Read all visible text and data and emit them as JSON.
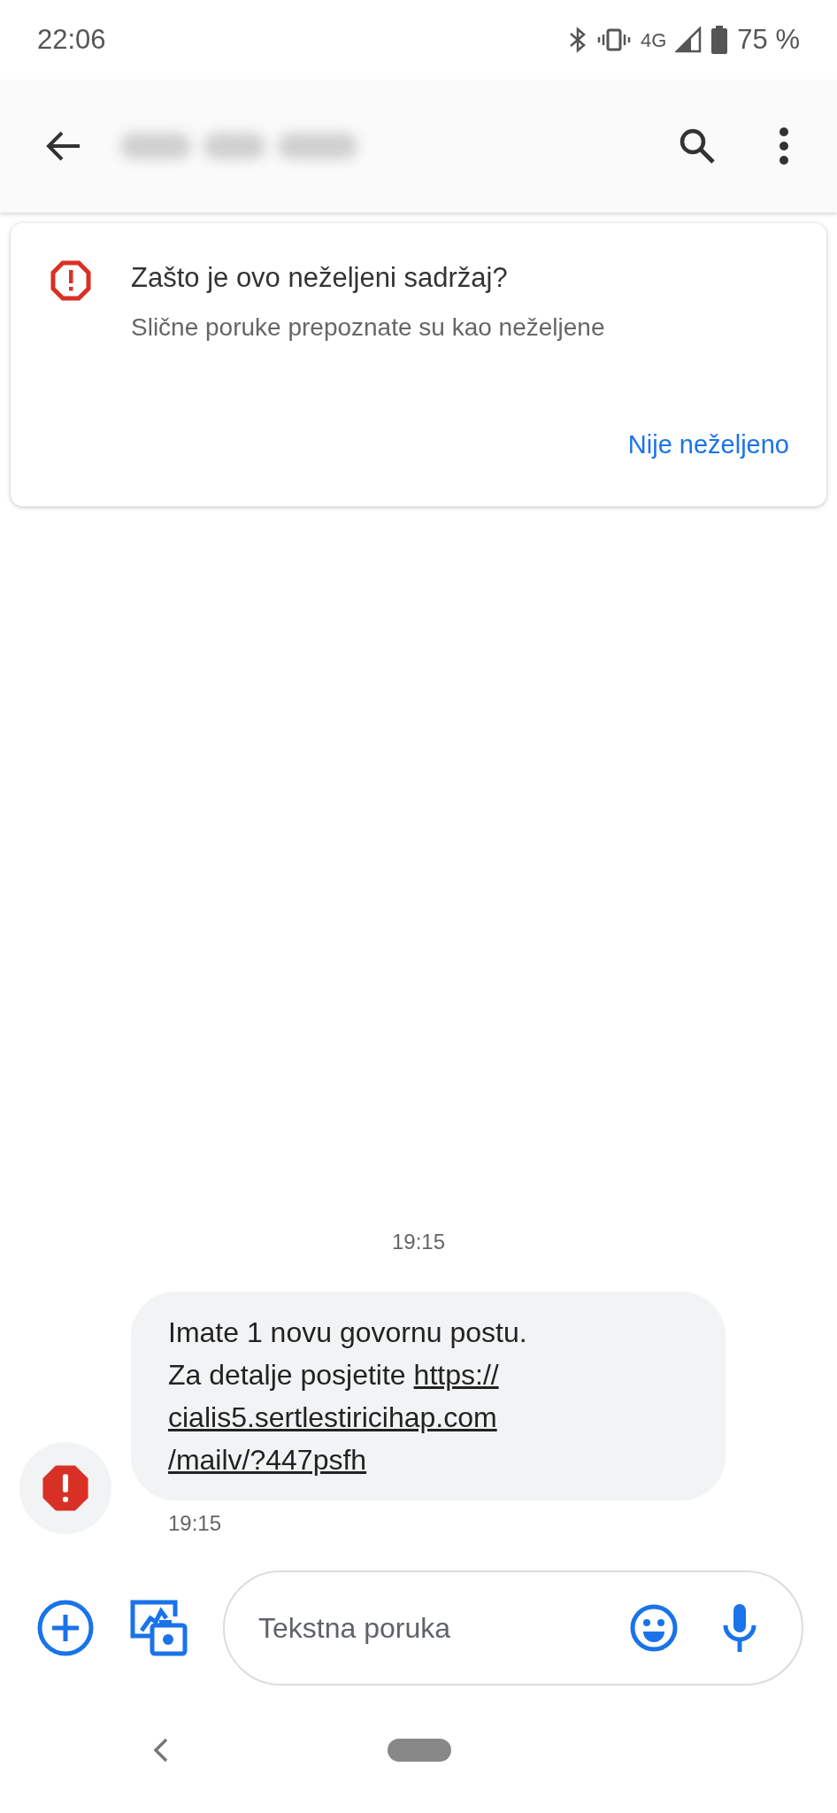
{
  "status_bar": {
    "time": "22:06",
    "network": "4G",
    "battery": "75 %"
  },
  "spam_card": {
    "title": "Zašto je ovo neželjeni sadržaj?",
    "subtitle": "Slične poruke prepoznate su kao neželjene",
    "action": "Nije neželjeno"
  },
  "conversation": {
    "timestamp": "19:15",
    "message": {
      "lines": [
        "Imate 1 novu govornu postu.",
        "Za detalje posjetite"
      ],
      "link_parts": [
        "https://",
        "cialis5.sertlestiricihap.com",
        "/mailv/?447psfh"
      ],
      "time": "19:15",
      "spam": true
    }
  },
  "composer": {
    "placeholder": "Tekstna poruka"
  }
}
